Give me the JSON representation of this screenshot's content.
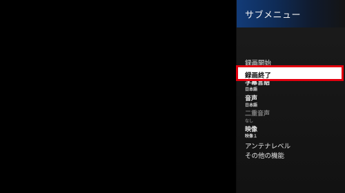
{
  "panel": {
    "title": "サブメニュー"
  },
  "menu": {
    "record_start": "録画開始",
    "record_stop": "録画終了",
    "subtitle_language": {
      "label": "字幕言語",
      "value": "日本語"
    },
    "audio": {
      "label": "音声",
      "value": "日本語"
    },
    "dual_audio": {
      "label": "二重音声",
      "value": "なし"
    },
    "video": {
      "label": "映像",
      "value": "映像１"
    },
    "antenna_level": "アンテナレベル",
    "other_functions": "その他の機能"
  },
  "colors": {
    "selection_border": "#e3000f",
    "header_blue": "#123b78"
  }
}
